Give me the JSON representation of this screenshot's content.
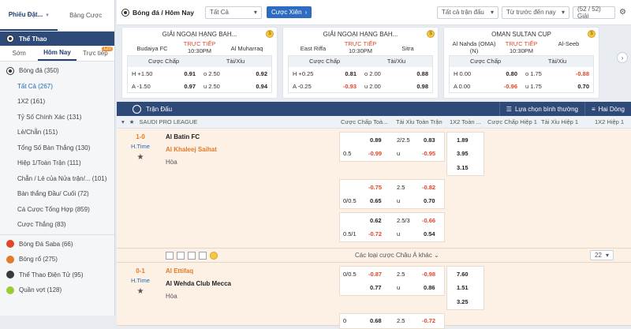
{
  "sidebar": {
    "tab_bets": "Phiếu Đặt...",
    "tab_slip": "Bảng Cược",
    "sport_header": "Thể Thao",
    "subtabs": [
      {
        "label": "Sớm"
      },
      {
        "label": "Hôm Nay"
      },
      {
        "label": "Trực tiếp",
        "badge": "120"
      }
    ],
    "items": [
      {
        "label": "Bóng đá (350)",
        "type": "sport"
      },
      {
        "label": "Tất Cả (267)",
        "active": true
      },
      {
        "label": "1X2 (161)"
      },
      {
        "label": "Tỷ Số Chính Xác (131)"
      },
      {
        "label": "Lẻ/Chẵn (151)"
      },
      {
        "label": "Tổng Số Bàn Thắng (130)"
      },
      {
        "label": "Hiệp 1/Toàn Trận (111)"
      },
      {
        "label": "Chẵn / Lẻ của Nửa trận/... (101)"
      },
      {
        "label": "Bàn thắng Đầu/ Cuối (72)"
      },
      {
        "label": "Cá Cược Tổng Hợp (859)"
      },
      {
        "label": "Cược Thắng (83)"
      }
    ],
    "sports": [
      {
        "label": "Bóng Đá Saba (66)",
        "color": "#e0462a"
      },
      {
        "label": "Bóng rổ (275)",
        "color": "#e07b2a"
      },
      {
        "label": "Thể Thao Điện Tử (95)",
        "color": "#3a3a3a"
      },
      {
        "label": "Quần vợt (128)",
        "color": "#9acd32"
      }
    ]
  },
  "topbar": {
    "title": "Bóng đá / Hôm Nay",
    "filter": "Tất Cả",
    "combo_button": "Cược Xiên",
    "all_leagues": "Tất cả trận đấu",
    "sort": "Từ trước đến nay",
    "count": "(52 / 52) Giải"
  },
  "cards": [
    {
      "league": "GIẢI NGOẠI HẠNG BAH...",
      "home": "Budaiya FC",
      "away": "Al Muharraq",
      "live": "TRỰC TIẾP",
      "time": "10:30PM",
      "h1": "Cược Chấp",
      "h2": "Tài/Xỉu",
      "rows": [
        {
          "a": "H +1.50",
          "b": "0.91",
          "c": "o 2.50",
          "d": "0.92"
        },
        {
          "a": "A -1.50",
          "b": "0.97",
          "c": "u 2.50",
          "d": "0.94"
        }
      ]
    },
    {
      "league": "GIẢI NGOẠI HẠNG BAH...",
      "home": "East Riffa",
      "away": "Sitra",
      "live": "TRỰC TIẾP",
      "time": "10:30PM",
      "h1": "Cược Chấp",
      "h2": "Tài/Xỉu",
      "rows": [
        {
          "a": "H +0.25",
          "b": "0.81",
          "c": "o 2.00",
          "d": "0.88"
        },
        {
          "a": "A -0.25",
          "b": "-0.93",
          "c": "u 2.00",
          "d": "0.98"
        }
      ]
    },
    {
      "league": "OMAN SULTAN CUP",
      "home": "Al Nahda (OMA) (N)",
      "away": "Al-Seeb",
      "live": "TRỰC TIẾP",
      "time": "10:30PM",
      "h1": "Cược Chấp",
      "h2": "Tài/Xỉu",
      "rows": [
        {
          "a": "H 0.00",
          "b": "0.80",
          "c": "o 1.75",
          "d": "-0.88"
        },
        {
          "a": "A 0.00",
          "b": "-0.96",
          "c": "u 1.75",
          "d": "0.70"
        }
      ]
    }
  ],
  "match_header": {
    "title": "Trận Đấu",
    "view": "Lựa chọn bình thường",
    "lines": "Hai Dòng"
  },
  "league": "SAUDI PRO LEAGUE",
  "columns": [
    "Cược Chấp Toà...",
    "Tài Xỉu Toàn Trận",
    "1X2 Toàn ...",
    "Cược Chấp Hiệp 1",
    "Tài Xỉu Hiệp 1",
    "1X2 Hiệp 1"
  ],
  "matches": [
    {
      "score": "1-0",
      "period": "H.Time",
      "home": "Al Batin FC",
      "away": "Al Khaleej Saihat",
      "draw": "Hòa",
      "groups": [
        {
          "hdp": [
            "",
            "0.5"
          ],
          "hodds": [
            "0.89",
            "-0.99"
          ],
          "ou": [
            "2/2.5",
            "u"
          ],
          "oodds": [
            "0.83",
            "-0.95"
          ],
          "x12": [
            "1.89",
            "3.95",
            "3.15"
          ]
        },
        {
          "hdp": [
            "",
            "0/0.5"
          ],
          "hodds": [
            "-0.75",
            "0.65"
          ],
          "ou": [
            "2.5",
            "u"
          ],
          "oodds": [
            "-0.82",
            "0.70"
          ]
        },
        {
          "hdp": [
            "",
            "0.5/1"
          ],
          "hodds": [
            "0.62",
            "-0.72"
          ],
          "ou": [
            "2.5/3",
            "u"
          ],
          "oodds": [
            "-0.66",
            "0.54"
          ]
        }
      ],
      "more": "Các loại cược Châu Á khác",
      "more_count": "22"
    },
    {
      "score": "0-1",
      "period": "H.Time",
      "home": "Al Ettifaq",
      "away": "Al Wehda Club Mecca",
      "draw": "Hòa",
      "groups": [
        {
          "hdp": [
            "0/0.5",
            ""
          ],
          "hodds": [
            "-0.87",
            "0.77"
          ],
          "ou": [
            "2.5",
            "u"
          ],
          "oodds": [
            "-0.98",
            "0.86"
          ],
          "x12": [
            "7.60",
            "1.51",
            "3.25"
          ]
        },
        {
          "hdp": [
            "0",
            ""
          ],
          "hodds": [
            "0.68",
            ""
          ],
          "ou": [
            "2.5",
            ""
          ],
          "oodds": [
            "-0.72",
            ""
          ]
        }
      ]
    }
  ]
}
